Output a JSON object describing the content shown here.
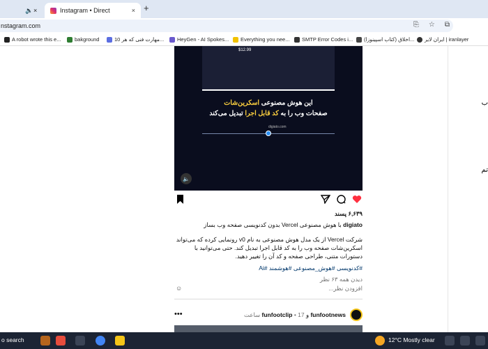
{
  "browser": {
    "tabs": [
      {
        "label": "Instagram • Direct",
        "active": true
      }
    ],
    "new_tab_glyph": "+",
    "tab_close_glyph": "×",
    "mute_glyph": "🔈",
    "url": "nstagram.com",
    "bookmarks": [
      {
        "label": "A robot wrote this e...",
        "color": "#222"
      },
      {
        "label": "bakground",
        "color": "#2f7d32"
      },
      {
        "label": "10 مهارت فنی که هر...",
        "color": "#5b6ee1"
      },
      {
        "label": "HeyGen - AI Spokes...",
        "color": "#6a5acd"
      },
      {
        "label": "Everything you nee...",
        "color": "#f2c200"
      },
      {
        "label": "SMTP Error Codes i...",
        "color": "#333"
      },
      {
        "label": "اخلاق (کتاب اسپینوزا)...",
        "color": "#444"
      },
      {
        "label": "ایران لایر | iranlayer",
        "color": "#333"
      }
    ]
  },
  "post": {
    "video": {
      "price": "$12.99",
      "line1": "این هوش مصنوعی",
      "line1_highlight": "اسکرین‌شات",
      "line2": "صفحات وب را به",
      "line2_highlight": "کد قابل اجرا",
      "line2_end": "تبدیل می‌کند",
      "site": "digiato.com",
      "sound_glyph": "🔈"
    },
    "likes": "۶,۶۳۹ پسند",
    "caption_user": "digiato",
    "caption": "با هوش مصنوعی Vercel بدون کدنویسی صفحه وب بساز",
    "description": "شرکت Vercel از یک مدل هوش مصنوعی به نام v0 رونمایی کرده که می‌تواند اسکرین‌شات صفحه وب را به کد قابل اجرا تبدیل کند. حتی می‌توانید با دستورات متنی، طراحی صفحه و کد آن را تغییر دهید.",
    "hashtags": "#کدنویسی #هوش_مصنوعی #هوشمند #Ai",
    "views": "دیدن همه ۶۳ نظر",
    "comment_placeholder": "افزودن نظر...",
    "emoji_glyph": "☺"
  },
  "next_post": {
    "user1": "funfootnews",
    "joiner": "و",
    "user2": "funfootclip",
    "time": "• 17 ساعت",
    "more_glyph": "•••"
  },
  "sidebar_right": {
    "fragment1": "ب",
    "fragment2": "تم"
  },
  "taskbar": {
    "search": "o search",
    "weather": "12°C  Mostly clear"
  }
}
